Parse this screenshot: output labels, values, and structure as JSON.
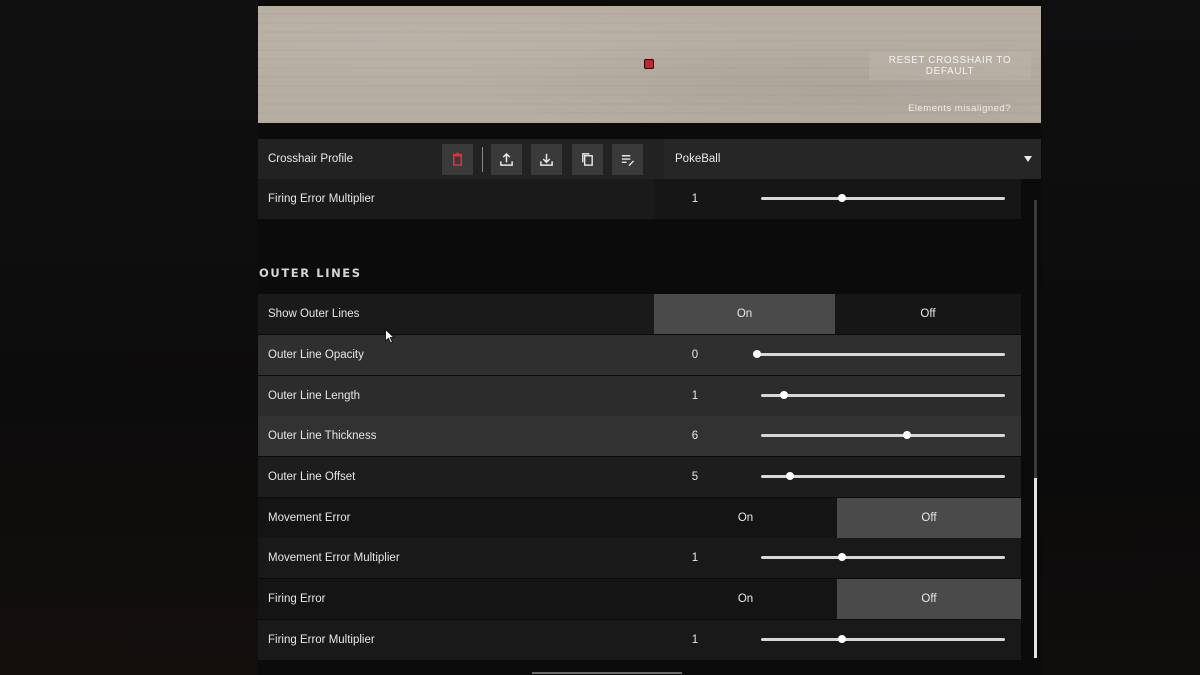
{
  "preview": {
    "reset_label": "RESET CROSSHAIR TO DEFAULT",
    "misaligned_label": "Elements misaligned?"
  },
  "profile": {
    "label": "Crosshair Profile",
    "selected": "PokeBall",
    "icons": [
      "delete-icon",
      "upload-icon",
      "download-icon",
      "copy-icon",
      "rename-icon"
    ]
  },
  "top_row": {
    "label": "Firing Error Multiplier",
    "value": "1",
    "slider_fraction": 0.33
  },
  "section": {
    "title": "OUTER LINES"
  },
  "rows": [
    {
      "label": "Show Outer Lines",
      "on_label": "On",
      "off_label": "Off",
      "selected": "On"
    },
    {
      "label": "Outer Line Opacity",
      "value": "0",
      "slider_fraction": 0.0
    },
    {
      "label": "Outer Line Length",
      "value": "1",
      "slider_fraction": 0.1
    },
    {
      "label": "Outer Line Thickness",
      "value": "6",
      "slider_fraction": 0.6
    },
    {
      "label": "Outer Line Offset",
      "value": "5",
      "slider_fraction": 0.12
    },
    {
      "label": "Movement Error",
      "on_label": "On",
      "off_label": "Off",
      "selected": "Off"
    },
    {
      "label": "Movement Error Multiplier",
      "value": "1",
      "slider_fraction": 0.33
    },
    {
      "label": "Firing Error",
      "on_label": "On",
      "off_label": "Off",
      "selected": "Off"
    },
    {
      "label": "Firing Error Multiplier",
      "value": "1",
      "slider_fraction": 0.33
    }
  ],
  "colors": {
    "crosshair_dot": "#c8222b",
    "row_light": "#303031",
    "row_dark": "#1a1a1b"
  }
}
